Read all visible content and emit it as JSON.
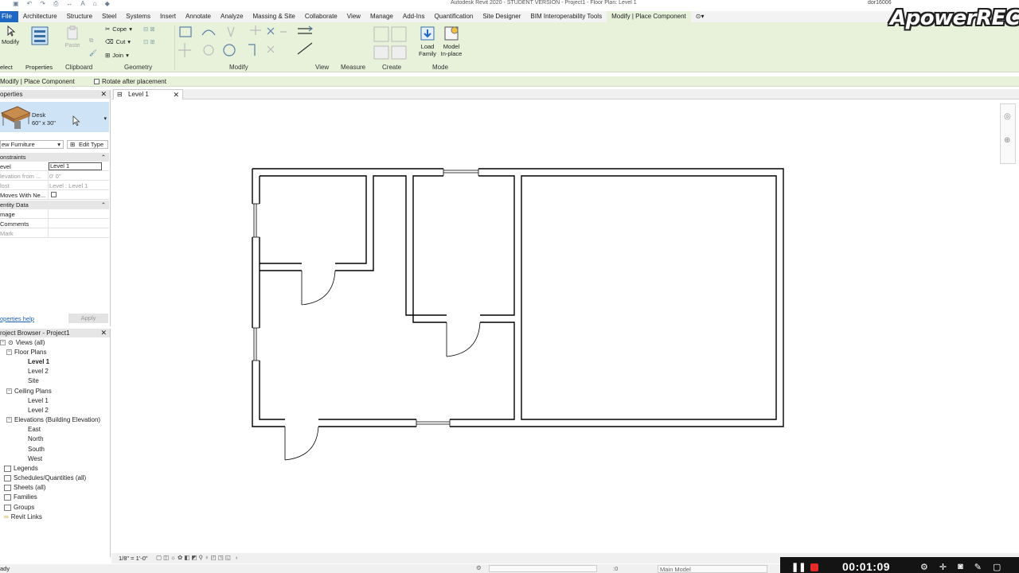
{
  "app": {
    "title": "Autodesk Revit 2020 - STUDENT VERSION - Project1 - Floor Plan: Level 1",
    "user": "dor16006",
    "watermark": "ApowerREC"
  },
  "ribbon_tabs": [
    "File",
    "Architecture",
    "Structure",
    "Steel",
    "Systems",
    "Insert",
    "Annotate",
    "Analyze",
    "Massing & Site",
    "Collaborate",
    "View",
    "Manage",
    "Add-Ins",
    "Quantification",
    "Site Designer",
    "BIM Interoperability Tools",
    "Modify | Place Component"
  ],
  "ribbon": {
    "modify_label": "Modify",
    "select_label": "elect",
    "properties_label": "Properties",
    "paste_label": "Paste",
    "clipboard_group": "Clipboard",
    "cope_label": "Cope",
    "cut_label": "Cut",
    "join_label": "Join",
    "geometry_group": "Geometry",
    "modify_group": "Modify",
    "view_group": "View",
    "measure_group": "Measure",
    "create_group": "Create",
    "load_family_label": "Load Family",
    "model_inplace_label": "Model In-place",
    "mode_group": "Mode"
  },
  "options_bar": {
    "context": "Modify | Place Component",
    "rotate_label": "Rotate after placement"
  },
  "properties": {
    "header": "operties",
    "type_name": "Desk",
    "type_size": "60\" x 30\"",
    "family_filter": "ew Furniture",
    "edit_type": "Edit Type",
    "cat_constraints": "onstraints",
    "level_key": "evel",
    "level_value": "Level 1",
    "elevation_key": "levation from ...",
    "elevation_value": "0' 0\"",
    "host_key": "lost",
    "host_value": "Level : Level 1",
    "moves_key": "Moves With Ne...",
    "cat_identity": "entity Data",
    "image_key": "mage",
    "comments_key": "Comments",
    "mark_key": "Mark",
    "help": "operties help",
    "apply": "Apply"
  },
  "project_browser": {
    "header": "roject Browser - Project1",
    "views_all": "Views (all)",
    "floor_plans": "Floor Plans",
    "fp_level1": "Level 1",
    "fp_level2": "Level 2",
    "fp_site": "Site",
    "ceiling_plans": "Ceiling Plans",
    "cp_level1": "Level 1",
    "cp_level2": "Level 2",
    "elevations": "Elevations (Building Elevation)",
    "east": "East",
    "north": "North",
    "south": "South",
    "west": "West",
    "legends": "Legends",
    "schedules": "Schedules/Quantities (all)",
    "sheets": "Sheets (all)",
    "families": "Families",
    "groups": "Groups",
    "revit_links": "Revit Links"
  },
  "doc_tab": "Level 1",
  "status": {
    "scale": "1/8\" = 1'-0\"",
    "ready": "ady",
    "model": "Main Model",
    "zero": ":0"
  },
  "recorder": {
    "time": "00:01:09"
  }
}
